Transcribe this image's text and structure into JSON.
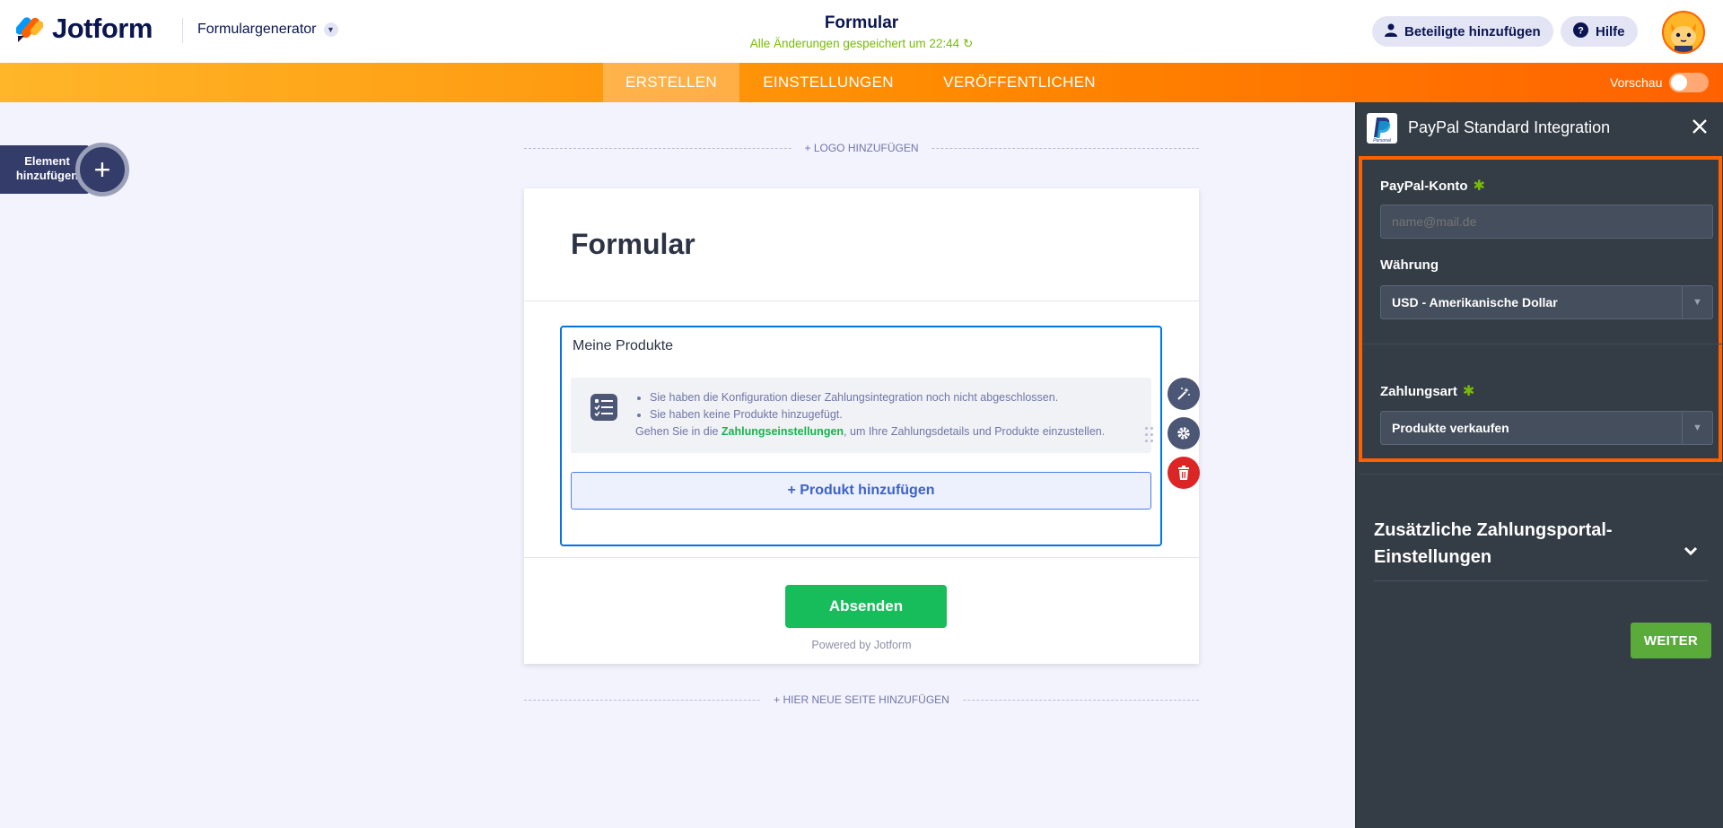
{
  "app": {
    "brand": "Jotform",
    "builder_switch_label": "Formulargenerator",
    "form_title_header": "Formular",
    "save_status": "Alle Änderungen gespeichert um 22:44",
    "add_collaborator_label": "Beteiligte hinzufügen",
    "help_label": "Hilfe"
  },
  "nav": {
    "tabs": [
      {
        "label": "ERSTELLEN",
        "active": true
      },
      {
        "label": "EINSTELLUNGEN",
        "active": false
      },
      {
        "label": "VERÖFFENTLICHEN",
        "active": false
      }
    ],
    "preview_label": "Vorschau",
    "preview_on": false
  },
  "canvas": {
    "add_element_label": "Element hinzufügen",
    "add_logo_label": "+ LOGO HINZUFÜGEN",
    "add_page_label": "+ HIER NEUE SEITE HINZUFÜGEN",
    "form": {
      "title": "Formular",
      "products_field": {
        "label": "Meine Produkte",
        "warnings": [
          "Sie haben die Konfiguration dieser Zahlungsintegration noch nicht abgeschlossen.",
          "Sie haben keine Produkte hinzugefügt."
        ],
        "hint_prefix": "Gehen Sie in die",
        "hint_link": "Zahlungseinstellungen",
        "hint_suffix": ", um Ihre Zahlungsdetails und Produkte einzustellen.",
        "add_product_label": "+ Produkt hinzufügen"
      },
      "submit_label": "Absenden",
      "powered_by": "Powered by Jotform"
    }
  },
  "panel": {
    "title": "PayPal Standard Integration",
    "paypal_logo_text": "Personal",
    "fields": {
      "account_label": "PayPal-Konto",
      "account_placeholder": "name@mail.de",
      "currency_label": "Währung",
      "currency_value": "USD - Amerikanische Dollar",
      "payment_type_label": "Zahlungsart",
      "payment_type_value": "Produkte verkaufen"
    },
    "extra_settings_label": "Zusätzliche Zahlungsportal-Einstellungen",
    "next_label": "WEITER"
  },
  "colors": {
    "accent_orange": "#ff6100",
    "nav_gradient_start": "#ffb629",
    "panel_bg": "#343c46",
    "submit_green": "#18bd5b",
    "required_star": "#78bb07",
    "field_focus": "#0075e3",
    "delete_red": "#dc2626"
  },
  "icons": {
    "builder_chevron": "chevron-down-icon",
    "collaborator": "user-icon",
    "help": "question-circle-icon",
    "add": "plus-icon",
    "wand": "magic-wand-icon",
    "settings": "gear-icon",
    "delete": "trash-icon",
    "close": "close-icon",
    "field_type": "list-checks-icon",
    "save_refresh": "refresh-icon"
  }
}
